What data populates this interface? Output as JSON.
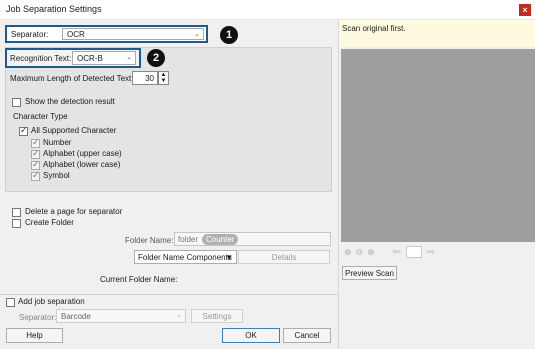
{
  "window": {
    "title": "Job Separation Settings",
    "close_glyph": "×"
  },
  "separator": {
    "label": "Separator:",
    "value": "OCR",
    "badge": "1"
  },
  "recognition": {
    "label": "Recognition Text:",
    "value": "OCR-B",
    "badge": "2"
  },
  "max_length": {
    "label": "Maximum Length of Detected Text:",
    "value": "30"
  },
  "show_detection": {
    "label": "Show the detection result",
    "checked": false
  },
  "character_type": {
    "title": "Character Type",
    "all": {
      "label": "All Supported Character",
      "checked": true
    },
    "items": [
      {
        "label": "Number",
        "checked": true
      },
      {
        "label": "Alphabet (upper case)",
        "checked": true
      },
      {
        "label": "Alphabet (lower case)",
        "checked": true
      },
      {
        "label": "Symbol",
        "checked": true
      }
    ]
  },
  "delete_page": {
    "label": "Delete a page for separator",
    "checked": false
  },
  "create_folder": {
    "label": "Create Folder",
    "checked": false
  },
  "folder_name": {
    "label": "Folder Name:",
    "prefix": "folder",
    "token": "Counter"
  },
  "folder_components": {
    "label": "Folder Name Components"
  },
  "details_button": {
    "label": "Details"
  },
  "current_folder": {
    "label": "Current Folder Name:"
  },
  "add_job": {
    "label": "Add job separation",
    "checked": false
  },
  "job_separator": {
    "label": "Separator:",
    "value": "Barcode"
  },
  "settings_button": {
    "label": "Settings"
  },
  "help_button": {
    "label": "Help"
  },
  "ok_button": {
    "label": "OK"
  },
  "cancel_button": {
    "label": "Cancel"
  },
  "preview": {
    "message": "Scan original first.",
    "button": "Preview Scan"
  }
}
